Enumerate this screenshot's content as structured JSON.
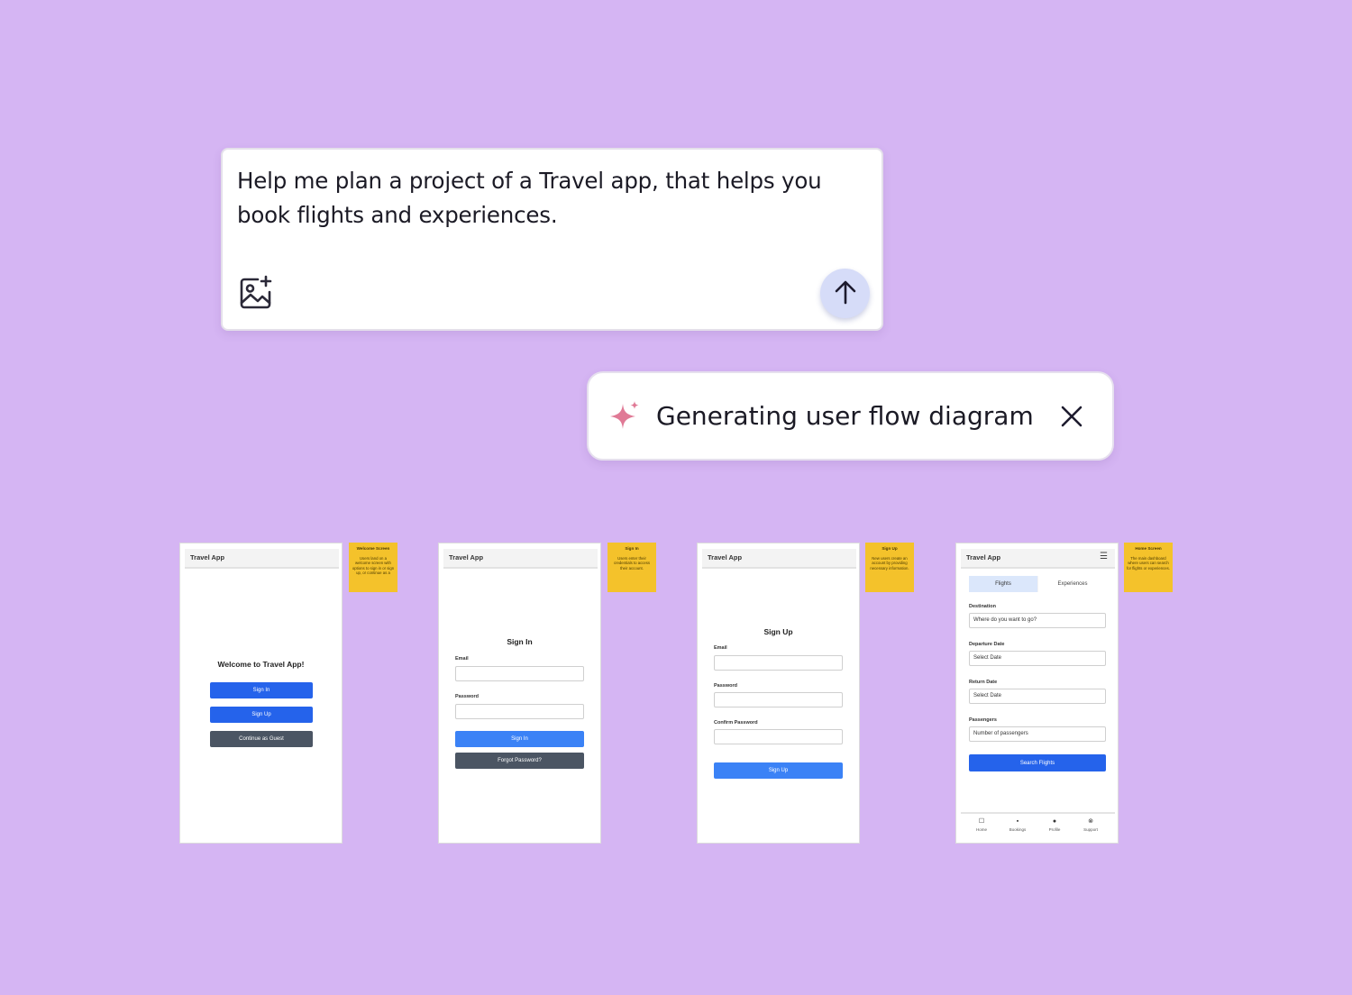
{
  "prompt": {
    "text": "Help me plan a project of a Travel app, that helps you book flights and experiences."
  },
  "status": {
    "text": "Generating user flow diagram"
  },
  "colors": {
    "background": "#d5b5f3",
    "sparkle": "#e07a96",
    "send_button": "#d6dcf8",
    "primary_blue": "#2563eb",
    "sticky_note": "#f4c22b"
  },
  "icons": {
    "image_add": "image-add-icon",
    "send": "arrow-up-icon",
    "sparkle": "sparkle-icon",
    "close": "close-icon"
  },
  "screens": {
    "welcome": {
      "app_title": "Travel App",
      "heading": "Welcome to Travel App!",
      "sign_in": "Sign In",
      "sign_up": "Sign Up",
      "guest": "Continue as Guest",
      "note_title": "Welcome Screen",
      "note_body": "Users land on a welcome screen with options to sign in or sign up, or continue as a"
    },
    "signin": {
      "app_title": "Travel App",
      "heading": "Sign In",
      "email_label": "Email",
      "password_label": "Password",
      "submit": "Sign In",
      "forgot": "Forgot Password?",
      "note_title": "Sign In",
      "note_body": "Users enter their credentials to access their account."
    },
    "signup": {
      "app_title": "Travel App",
      "heading": "Sign Up",
      "email_label": "Email",
      "password_label": "Password",
      "confirm_label": "Confirm Password",
      "submit": "Sign Up",
      "note_title": "Sign Up",
      "note_body": "New users create an account by providing necessary information."
    },
    "home": {
      "app_title": "Travel App",
      "tab_flights": "Flights",
      "tab_experiences": "Experiences",
      "destination_label": "Destination",
      "destination_value": "Where do you want to go?",
      "departure_label": "Departure Date",
      "departure_value": "Select Date",
      "return_label": "Return Date",
      "return_value": "Select Date",
      "passengers_label": "Passengers",
      "passengers_value": "Number of passengers",
      "search": "Search Flights",
      "nav": [
        "Home",
        "Bookings",
        "Profile",
        "Support"
      ],
      "note_title": "Home Screen",
      "note_body": "The main dashboard where users can search for flights or experiences."
    }
  }
}
